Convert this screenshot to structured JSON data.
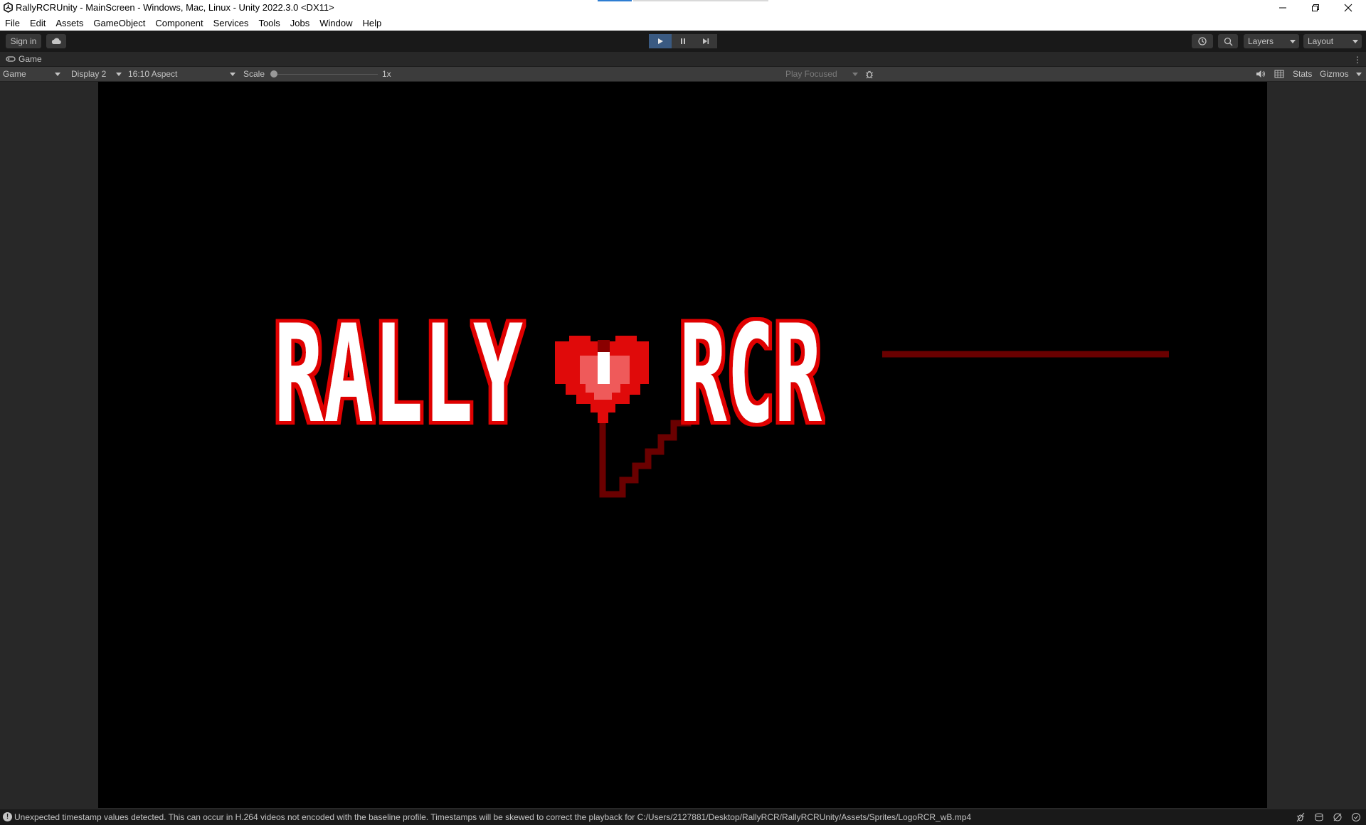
{
  "window": {
    "title": "RallyRCRUnity - MainScreen - Windows, Mac, Linux - Unity 2022.3.0 <DX11>",
    "controls": [
      "minimize-icon",
      "restore-icon",
      "close-icon"
    ]
  },
  "menu": {
    "items": [
      "File",
      "Edit",
      "Assets",
      "GameObject",
      "Component",
      "Services",
      "Tools",
      "Jobs",
      "Window",
      "Help"
    ]
  },
  "toolbar": {
    "sign_in": "Sign in",
    "cloud_icon": "cloud-icon",
    "play_state": "playing",
    "layers": "Layers",
    "layout": "Layout"
  },
  "tab": {
    "label": "Game"
  },
  "game_toolbar": {
    "view": "Game",
    "display": "Display 2",
    "aspect": "16:10 Aspect",
    "scale_label": "Scale",
    "scale_value": "1x",
    "play_mode": "Play Focused",
    "stats": "Stats",
    "gizmos": "Gizmos"
  },
  "logo": {
    "left_text": "RALLY",
    "right_text": "RCR",
    "fill_color": "#ffffff",
    "outline_color": "#e00000",
    "heart_color": "#e00a0a",
    "wire_color": "#6a0000"
  },
  "status": {
    "message": "Unexpected timestamp values detected. This can occur in H.264 videos not encoded with the baseline profile. Timestamps will be skewed to correct the playback for C:/Users/2127881/Desktop/RallyRCR/RallyRCRUnity/Assets/Sprites/LogoRCR_wB.mp4"
  },
  "colors": {
    "accent_play": "#3a5a82",
    "editor_dark": "#191919",
    "panel": "#282828"
  }
}
